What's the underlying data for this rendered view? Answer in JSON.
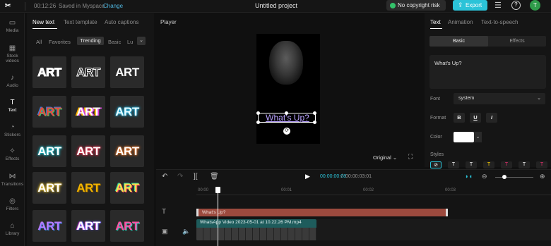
{
  "topbar": {
    "logo": "✂",
    "time": "00:12:26",
    "saved": "Saved in Myspace",
    "change": "Change",
    "project": "Untitled project",
    "copyright": "No copyright risk",
    "export": "Export",
    "avatar": "T"
  },
  "nav": [
    {
      "label": "Media",
      "icon": "▭"
    },
    {
      "label": "Stock videos",
      "icon": "▦"
    },
    {
      "label": "Audio",
      "icon": "♪"
    },
    {
      "label": "Text",
      "icon": "T"
    },
    {
      "label": "Stickers",
      "icon": "◔"
    },
    {
      "label": "Effects",
      "icon": "✧"
    },
    {
      "label": "Transitions",
      "icon": "⋈"
    },
    {
      "label": "Filters",
      "icon": "◎"
    },
    {
      "label": "Library",
      "icon": "⌂"
    }
  ],
  "panel": {
    "tabs": [
      "New text",
      "Text template",
      "Auto captions"
    ],
    "filters": [
      "All",
      "Favorites",
      "Trending",
      "Basic",
      "Lu"
    ],
    "tile_text": "ART"
  },
  "player": {
    "label": "Player",
    "caption": "What's Up?",
    "ratio": "Original"
  },
  "right": {
    "tabs": [
      "Text",
      "Animation",
      "Text-to-speech"
    ],
    "segments": [
      "Basic",
      "Effects"
    ],
    "text_value": "What's Up?",
    "font_label": "Font",
    "font_value": "system",
    "format_label": "Format",
    "format_buttons": [
      "B",
      "U",
      "I"
    ],
    "color_label": "Color",
    "styles_label": "Styles",
    "color": "#ffffff"
  },
  "timeline": {
    "current": "00:00:00:08",
    "duration": "00:00:03:01",
    "ticks": [
      "00:00",
      "00:01",
      "00:02",
      "00:03"
    ],
    "text_clip": "What's Up?",
    "video_clip": "WhatsApp Video 2023-05-01 at 10.22.26 PM.mp4"
  }
}
